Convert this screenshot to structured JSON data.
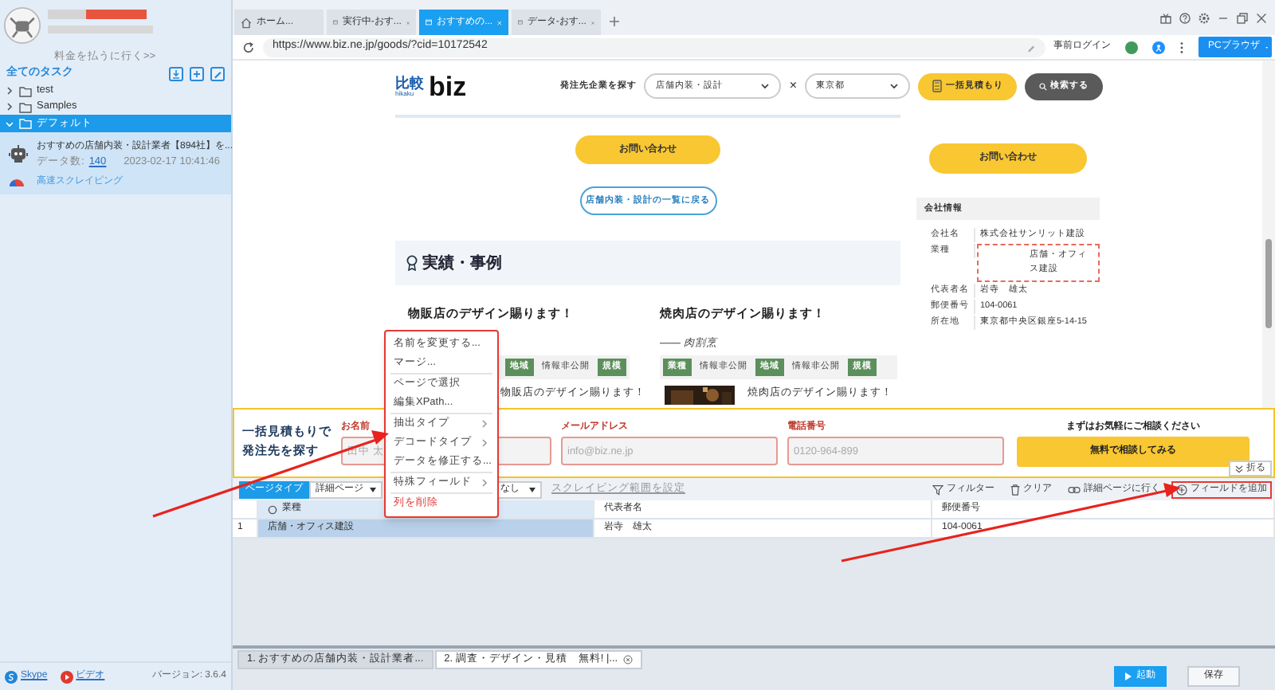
{
  "sidebar": {
    "billing_link": "料金を払うに行く>>",
    "all_tasks": "全てのタスク",
    "tree": [
      {
        "label": "test",
        "expanded": false,
        "selected": false
      },
      {
        "label": "Samples",
        "expanded": false,
        "selected": false
      },
      {
        "label": "デフォルト",
        "expanded": true,
        "selected": true,
        "children": [
          {
            "title": "おすすめの店舗内装・設計業者【894社】を...",
            "data_count_label": "データ数:",
            "data_count": "140",
            "date": "2023-02-17 10:41:46",
            "mode": "高速スクレイピング"
          }
        ]
      }
    ],
    "footer": {
      "skype": "Skype",
      "video": "ビデオ",
      "version": "バージョン: 3.6.4"
    }
  },
  "browser_tabs": [
    {
      "label": "ホーム...",
      "kind": "home",
      "selected": false
    },
    {
      "label": "実行中-おす...",
      "kind": "page",
      "selected": false
    },
    {
      "label": "おすすめの...",
      "kind": "page",
      "selected": true
    },
    {
      "label": "データ-おす...",
      "kind": "page",
      "selected": false
    }
  ],
  "address_bar": {
    "url": "https://www.biz.ne.jp/goods/?cid=10172542",
    "login": "事前ログイン",
    "browser_mode": "PCブラウザ"
  },
  "web_page": {
    "logo": {
      "main": "比較",
      "sub": "hikaku",
      "brand": "biz"
    },
    "search_label": "発注先企業を探す",
    "category": "店舗内装・設計",
    "times": "×",
    "area": "東京都",
    "estimate_button": "一括見積もり",
    "search_button": "検索する",
    "contact_button": "お問い合わせ",
    "back_button": "店舗内装・設計の一覧に戻る",
    "side_contact_button": "お問い合わせ",
    "company": {
      "title": "会社情報",
      "rows": [
        {
          "label": "会社名",
          "value": "株式会社サンリット建設",
          "highlighted": false
        },
        {
          "label": "業種",
          "value": "店舗・オフィス建設",
          "highlighted": true
        },
        {
          "label": "代表者名",
          "value": "岩寺　雄太",
          "highlighted": false
        },
        {
          "label": "郵便番号",
          "value": "104-0061",
          "highlighted": false
        },
        {
          "label": "所在地",
          "value": "東京都中央区銀座5-14-15",
          "highlighted": false
        }
      ]
    },
    "section_title": "実績・事例",
    "cards": [
      {
        "title": "物販店のデザイン賜ります！",
        "tags": [
          {
            "text": "地域",
            "kind": "tag"
          },
          {
            "text": "情報非公開",
            "kind": "text"
          },
          {
            "text": "規模",
            "kind": "tag"
          }
        ],
        "footer_text": "物販店のデザイン賜ります！"
      },
      {
        "title": "焼肉店のデザイン賜ります！",
        "subtitle": "—— 肉割烹",
        "tags": [
          {
            "text": "業種",
            "kind": "tag"
          },
          {
            "text": "情報非公開",
            "kind": "text"
          },
          {
            "text": "地域",
            "kind": "tag"
          },
          {
            "text": "情報非公開",
            "kind": "text"
          },
          {
            "text": "規模",
            "kind": "tag"
          }
        ],
        "footer_text": "焼肉店のデザイン賜ります！"
      }
    ],
    "form": {
      "lead": "一括見積もりで発注先を探す",
      "fields": [
        {
          "label": "お名前",
          "placeholder": "田中 太"
        },
        {
          "label": "メールアドレス",
          "placeholder": "info@biz.ne.jp"
        },
        {
          "label": "電話番号",
          "placeholder": "0120-964-899"
        }
      ],
      "cta_caption": "まずはお気軽にご相談ください",
      "cta_button": "無料で相談してみる"
    }
  },
  "context_menu": {
    "highlighted": true,
    "groups": [
      [
        {
          "label": "名前を変更する...",
          "kind": "action"
        },
        {
          "label": "マージ...",
          "kind": "action"
        }
      ],
      [
        {
          "label": "ページで選択",
          "kind": "action"
        },
        {
          "label": "編集XPath...",
          "kind": "action"
        }
      ],
      [
        {
          "label": "抽出タイプ",
          "kind": "submenu"
        },
        {
          "label": "デコードタイプ",
          "kind": "submenu"
        },
        {
          "label": "データを修正する...",
          "kind": "action"
        }
      ],
      [
        {
          "label": "特殊フィールド",
          "kind": "submenu"
        }
      ],
      [
        {
          "label": "列を削除",
          "kind": "danger"
        }
      ]
    ]
  },
  "fold_button": "折る",
  "toolbar": {
    "page_type_label": "ページタイプ",
    "page_type": "詳細ページ",
    "option_value": "なし",
    "range_link": "スクレイピング範囲を設定",
    "actions": [
      {
        "label": "フィルター",
        "kind": "filter",
        "highlighted": false
      },
      {
        "label": "クリア",
        "kind": "clear",
        "highlighted": false
      },
      {
        "label": "詳細ページに行く",
        "kind": "link",
        "highlighted": false
      },
      {
        "label": "フィールドを追加",
        "kind": "add",
        "highlighted": true
      }
    ]
  },
  "table": {
    "columns": [
      {
        "label": "業種",
        "selected": true
      },
      {
        "label": "代表者名",
        "selected": false
      },
      {
        "label": "郵便番号",
        "selected": false
      }
    ],
    "rows": [
      {
        "index": "1",
        "cells": [
          "店舗・オフィス建設",
          "岩寺　雄太",
          "104-0061"
        ]
      }
    ]
  },
  "task_tabs": [
    {
      "label": "1. おすすめの店舗内装・設計業者...",
      "selected": false
    },
    {
      "label": "2. 調査・デザイン・見積　無料! |...",
      "selected": true
    }
  ],
  "buttons": {
    "start": "起動",
    "save": "保存"
  }
}
